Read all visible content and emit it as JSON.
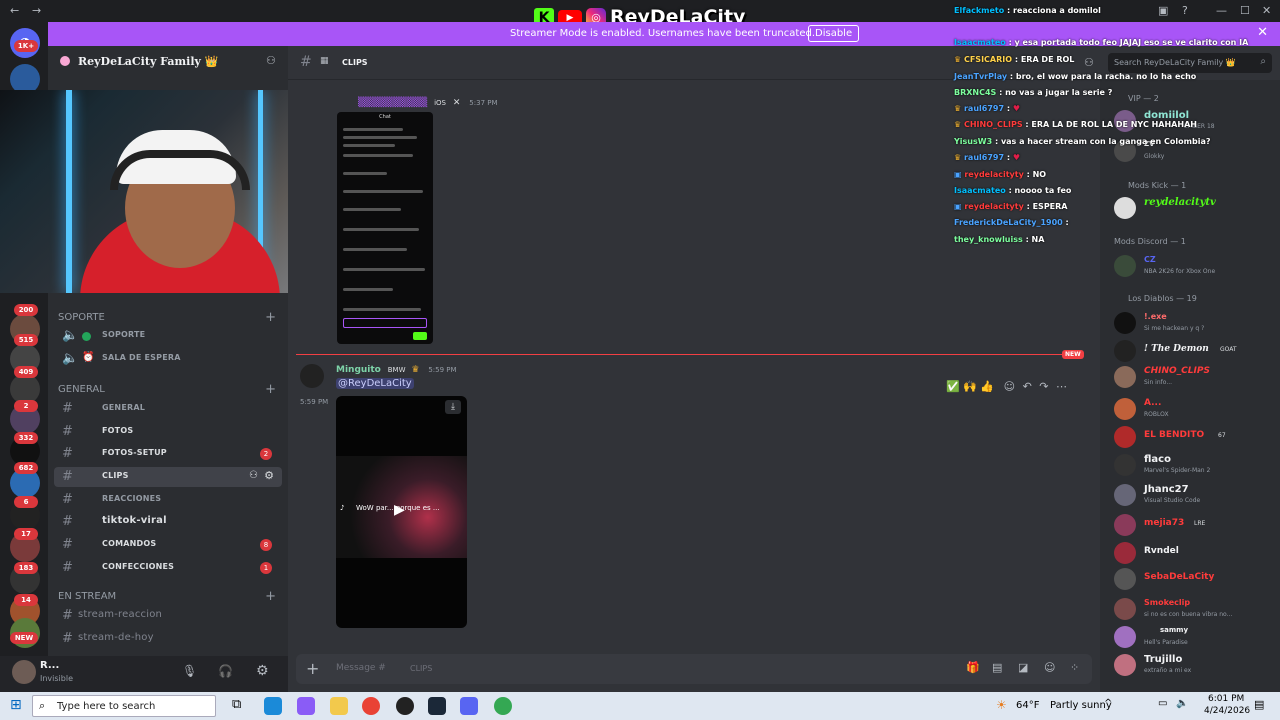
{
  "banner": {
    "text": "Streamer Mode is enabled. Usernames have been truncated.",
    "button": "Disable",
    "logo": "ReyDeLaCity"
  },
  "servers": {
    "badges": [
      "1K+",
      "200",
      "515",
      "409",
      "2",
      "332",
      "682",
      "6",
      "17",
      "183",
      "14",
      "NEW"
    ]
  },
  "sidebar": {
    "guild_name": "ReyDeLaCity Family 👑",
    "categories": {
      "soporte": "SOPORTE",
      "general": "GENERAL",
      "en_stream": "EN STREAM"
    },
    "voice": [
      "SOPORTE",
      "SALA DE ESPERA"
    ],
    "channels": [
      {
        "label": "GENERAL"
      },
      {
        "label": "FOTOS"
      },
      {
        "label": "FOTOS-SETUP",
        "badge": "2"
      },
      {
        "label": "CLIPS"
      },
      {
        "label": "REACCIONES"
      },
      {
        "label": "tiktok-viral"
      },
      {
        "label": "COMANDOS",
        "badge": "8"
      },
      {
        "label": "CONFECCIONES",
        "badge": "1"
      }
    ],
    "stream_channels": [
      "stream-reaccion",
      "stream-de-hoy"
    ]
  },
  "user": {
    "name": "R...",
    "status": "Invisible"
  },
  "channel_header": {
    "name": "CLIPS"
  },
  "messages": [
    {
      "time": "5:37 PM",
      "tag": "iOS"
    },
    {
      "author": "Minguito",
      "tag": "BMW",
      "time": "5:59 PM",
      "mention": "@ReyDeLaCity",
      "side_time": "5:59 PM",
      "video_caption": "WoW par... porque es ..."
    }
  ],
  "new_label": "NEW",
  "input": {
    "placeholder": "Message #",
    "channel": "CLIPS"
  },
  "screenshot_title": "Chat",
  "overlay_chat": [
    {
      "user": "Elfackmeto",
      "text": ": reacciona a domilol",
      "color": "#00bfff"
    },
    {
      "user": "Isaacmateo",
      "text": ": y esa portada todo feo JAJAJ eso se ve clarito con IA",
      "color": "#00bfff"
    },
    {
      "user": "CFSICARIO",
      "text": ": ERA DE ROL",
      "color": "#ffd24a"
    },
    {
      "user": "JeanTvrPlay",
      "text": ": bro, el wow para la racha. no lo ha echo",
      "color": "#4aa3ff"
    },
    {
      "user": "BRXNC4S",
      "text": ": no vas a jugar la serie ?",
      "color": "#7dff9e"
    },
    {
      "user": "raul6797",
      "text": ":",
      "color": "#4aa3ff"
    },
    {
      "user": "CHINO_CLIPS",
      "text": ": ERA LA DE ROL LA DE NYC HAHAHAH",
      "color": "#ff3b3b"
    },
    {
      "user": "YisusW3",
      "text": ": vas a hacer stream con la ganga en Colombia?",
      "color": "#7dff9e"
    },
    {
      "user": "raul6797",
      "text": ":",
      "color": "#4aa3ff"
    },
    {
      "user": "reydelacityty",
      "text": ": NO",
      "color": "#ff3b3b"
    },
    {
      "user": "Isaacmateo",
      "text": ": noooo ta feo",
      "color": "#00bfff"
    },
    {
      "user": "reydelacityty",
      "text": ": ESPERA",
      "color": "#ff3b3b"
    },
    {
      "user": "FrederickDeLaCity_1900",
      "text": ":",
      "color": "#4aa3ff"
    },
    {
      "user": "they_knowluiss",
      "text": ": NA",
      "color": "#7dff9e"
    }
  ],
  "members": {
    "search_placeholder": "Search ReyDeLaCity Family 👑",
    "groups": [
      {
        "title": "VIP — 2"
      },
      {
        "title": "Mods Kick — 1"
      },
      {
        "title": "Mods Discord — 1"
      },
      {
        "title": "Los Diablos — 19"
      }
    ],
    "list": [
      {
        "name": "domiilol",
        "status": "EMBER 18"
      },
      {
        "name": "ZV",
        "status": "Glokky"
      },
      {
        "name": "reydelacitytv",
        "status": ""
      },
      {
        "name": "CZ",
        "status": "NBA 2K26 for Xbox One"
      },
      {
        "name": "!.exe",
        "status": "Si me hackean y q ?"
      },
      {
        "name": "! The Demon",
        "status": "GOAT"
      },
      {
        "name": "CHINO_CLIPS",
        "status": "Sin info..."
      },
      {
        "name": "A...",
        "status": "ROBLOX"
      },
      {
        "name": "EL BENDITO",
        "status": "67"
      },
      {
        "name": "flaco",
        "status": "Marvel's Spider-Man 2"
      },
      {
        "name": "Jhanc27",
        "status": "Visual Studio Code"
      },
      {
        "name": "mejia73",
        "status": "LRE"
      },
      {
        "name": "Rvndel",
        "status": ""
      },
      {
        "name": "SebaDeLaCity",
        "status": ""
      },
      {
        "name": "Smokeclip",
        "status": "si no es con buena vibra no..."
      },
      {
        "name": "sammy",
        "status": "Hell's Paradise"
      },
      {
        "name": "Trujillo",
        "status": "extraño a mi ex"
      }
    ]
  },
  "taskbar": {
    "search": "Type here to search",
    "weather_temp": "64°F",
    "weather_text": "Partly sunny",
    "time": "6:01 PM",
    "date": "4/24/2026"
  }
}
